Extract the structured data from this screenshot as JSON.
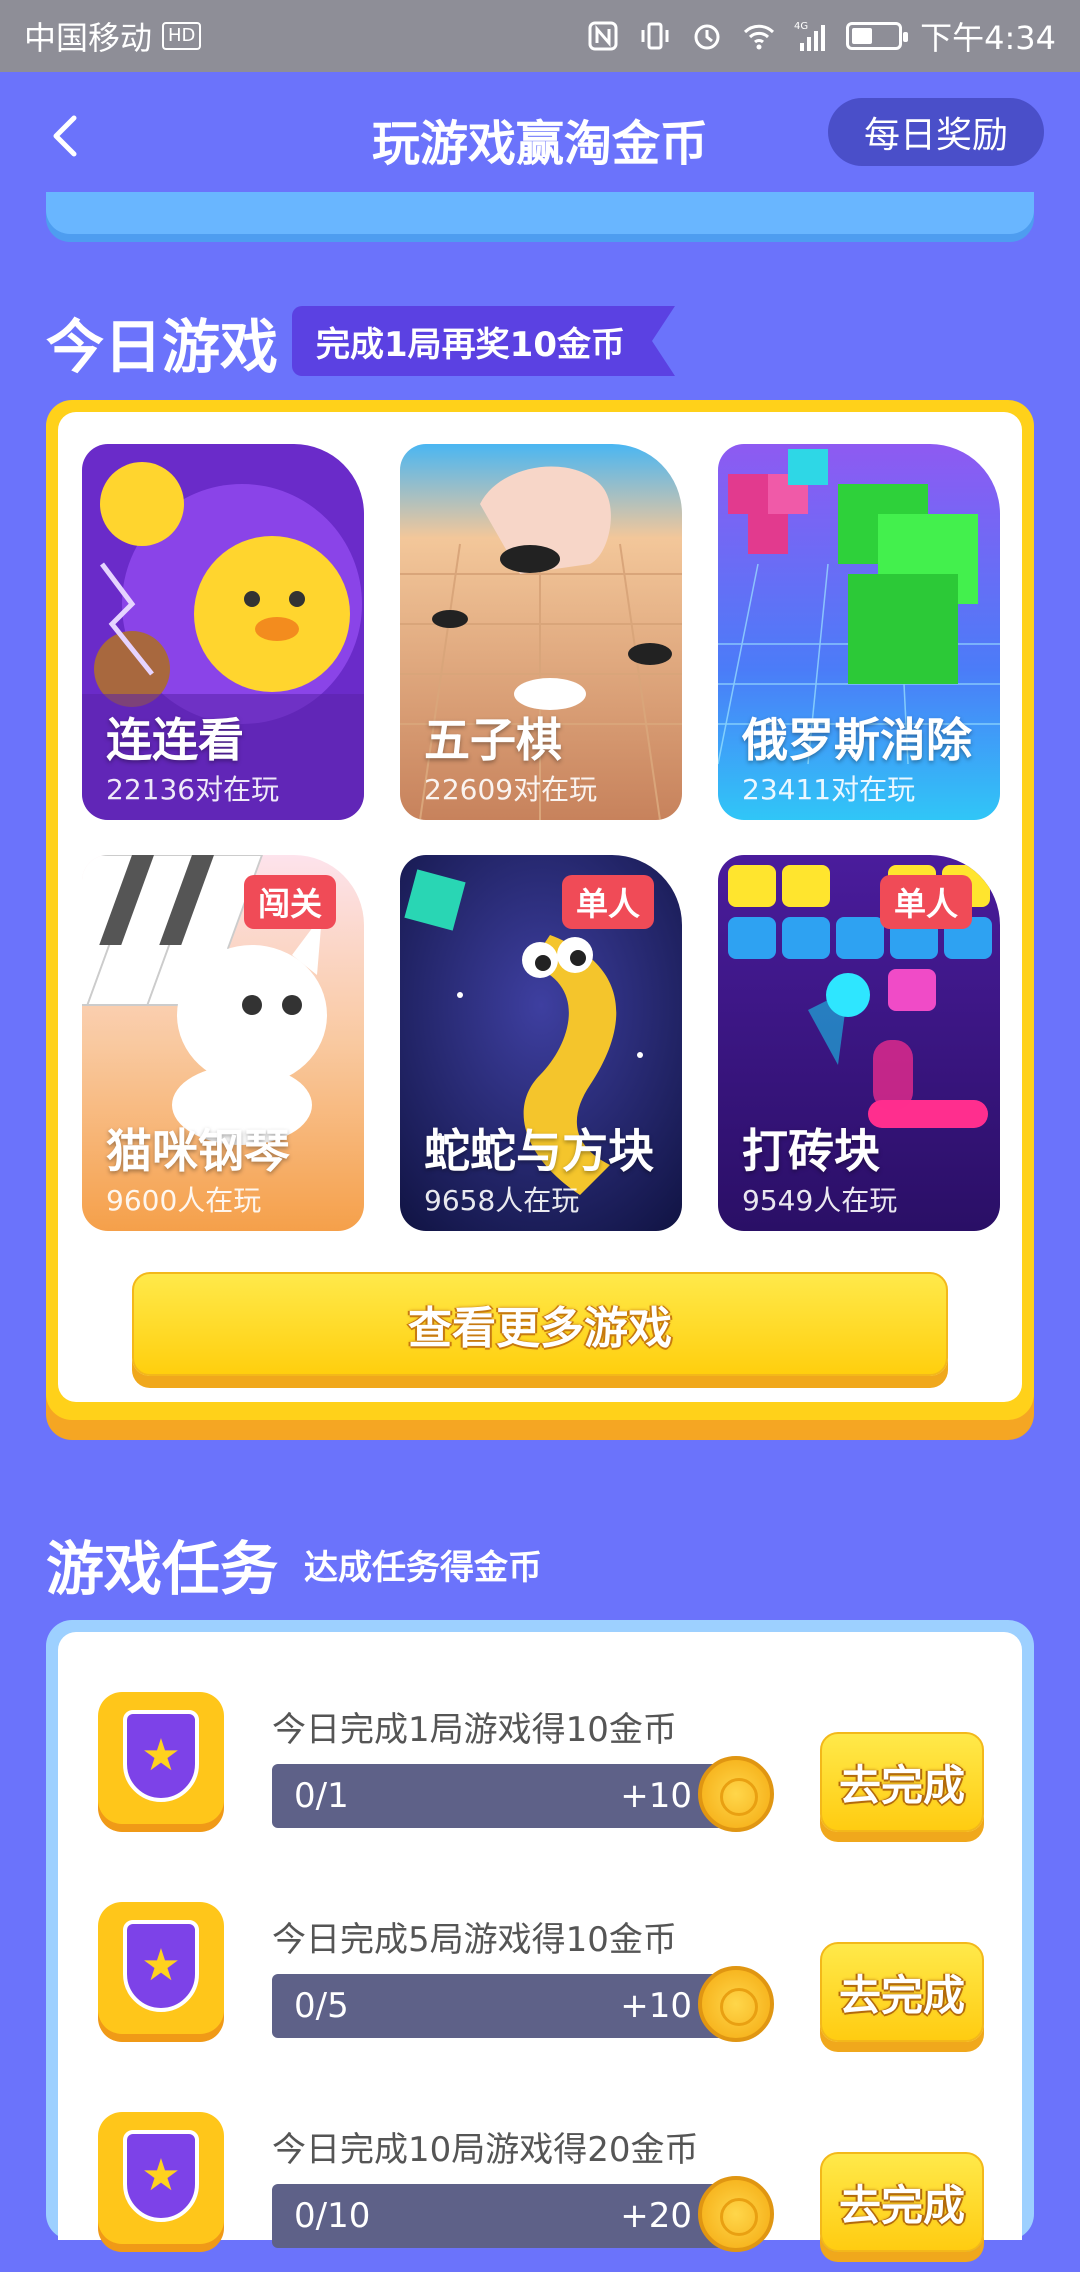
{
  "status_bar": {
    "carrier": "中国移动",
    "hd": "HD",
    "network": "4G",
    "time": "下午4:34"
  },
  "header": {
    "title": "玩游戏赢淘金币",
    "daily_reward": "每日奖励"
  },
  "today_games": {
    "title": "今日游戏",
    "ribbon": "完成1局再奖10金币",
    "games": [
      {
        "name": "连连看",
        "players": "22136对在玩",
        "tag": ""
      },
      {
        "name": "五子棋",
        "players": "22609对在玩",
        "tag": ""
      },
      {
        "name": "俄罗斯消除",
        "players": "23411对在玩",
        "tag": ""
      },
      {
        "name": "猫咪钢琴",
        "players": "9600人在玩",
        "tag": "闯关"
      },
      {
        "name": "蛇蛇与方块",
        "players": "9658人在玩",
        "tag": "单人"
      },
      {
        "name": "打砖块",
        "players": "9549人在玩",
        "tag": "单人"
      }
    ],
    "more_button": "查看更多游戏"
  },
  "game_tasks": {
    "title": "游戏任务",
    "subtitle": "达成任务得金币",
    "tasks": [
      {
        "text": "今日完成1局游戏得10金币",
        "progress": "0/1",
        "reward": "+10",
        "button": "去完成"
      },
      {
        "text": "今日完成5局游戏得10金币",
        "progress": "0/5",
        "reward": "+10",
        "button": "去完成"
      },
      {
        "text": "今日完成10局游戏得20金币",
        "progress": "0/10",
        "reward": "+20",
        "button": "去完成"
      }
    ]
  },
  "colors": {
    "background": "#6B73FB",
    "card_border": "#FFD11A",
    "button_yellow": "#FFD11A",
    "progress_bg": "#5E6188"
  }
}
